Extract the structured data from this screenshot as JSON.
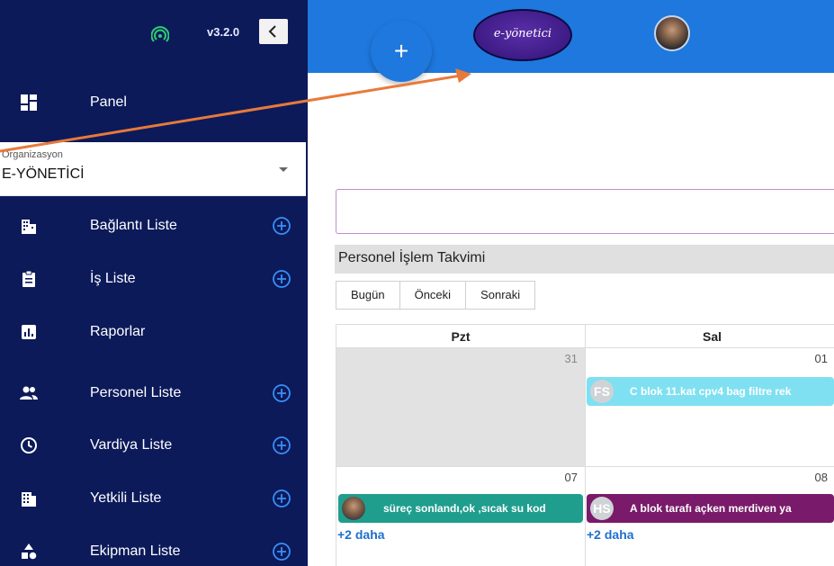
{
  "sidebar": {
    "version": "v3.2.0",
    "org_caption": "Organizasyon",
    "org_value": "E-YÖNETİCİ",
    "items": [
      {
        "label": "Panel",
        "icon": "dashboard-icon",
        "add": false
      },
      {
        "label": "Bağlantı Liste",
        "icon": "buildings-icon",
        "add": true
      },
      {
        "label": "İş Liste",
        "icon": "clipboard-icon",
        "add": true
      },
      {
        "label": "Raporlar",
        "icon": "chart-icon",
        "add": false
      },
      {
        "label": "Personel Liste",
        "icon": "people-icon",
        "add": true
      },
      {
        "label": "Vardiya Liste",
        "icon": "clock-icon",
        "add": true
      },
      {
        "label": "Yetkili Liste",
        "icon": "building-icon",
        "add": true
      },
      {
        "label": "Ekipman Liste",
        "icon": "shapes-icon",
        "add": true
      }
    ]
  },
  "topbar": {
    "fab_label": "+",
    "logo_text": "e-yönetici"
  },
  "calendar": {
    "title": "Personel İşlem Takvimi",
    "buttons": [
      "Bugün",
      "Önceki",
      "Sonraki"
    ],
    "headers": [
      "Pzt",
      "Sal"
    ],
    "days": {
      "r1c1": "31",
      "r1c2": "01",
      "r2c1": "07",
      "r2c2": "08"
    },
    "events": [
      {
        "initials": "FS",
        "text": "C blok 11.kat cpv4 bag filtre rek",
        "color": "#7fe0f2"
      },
      {
        "initials": "",
        "text": "süreç sonlandı,ok ,sıcak su kod",
        "color": "#1f9e8e"
      },
      {
        "initials": "HS",
        "text": "A blok tarafı açken merdiven ya",
        "color": "#7a1a6a"
      }
    ],
    "more": "+2 daha"
  },
  "colors": {
    "sidebar_bg": "#0c1a5a",
    "topbar_bg": "#1e78dd",
    "arrow": "#e8793a"
  }
}
